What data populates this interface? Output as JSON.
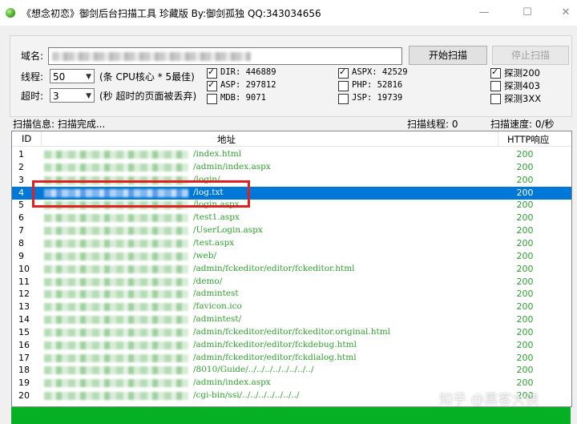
{
  "window": {
    "title": "《想念初恋》御剑后台扫描工具 珍藏版 By:御剑孤独 QQ:343034656",
    "minimize": "—",
    "maximize": "☐",
    "close": "✕"
  },
  "form": {
    "domain_label": "域名:",
    "threads_label": "线程:",
    "threads_value": "50",
    "threads_hint": "(条 CPU核心 * 5最佳)",
    "timeout_label": "超时:",
    "timeout_value": "3",
    "timeout_hint": "(秒 超时的页面被丢弃)",
    "start_button": "开始扫描",
    "stop_button": "停止扫描"
  },
  "dictionaries": [
    {
      "label": "DIR: 446889",
      "checked": true
    },
    {
      "label": "ASP: 297812",
      "checked": true
    },
    {
      "label": "MDB: 9071",
      "checked": false
    },
    {
      "label": "ASPX: 42529",
      "checked": true
    },
    {
      "label": "PHP: 52816",
      "checked": false
    },
    {
      "label": "JSP: 19739",
      "checked": false
    },
    {
      "label": "探测200",
      "checked": true
    },
    {
      "label": "探测403",
      "checked": false
    },
    {
      "label": "探测3XX",
      "checked": false
    }
  ],
  "status": {
    "scan_info": "扫描信息: 扫描完成...",
    "scan_threads": "扫描线程: 0",
    "scan_speed": "扫描速度: 0/秒"
  },
  "table": {
    "columns": [
      "ID",
      "地址",
      "HTTP响应"
    ],
    "rows": [
      {
        "id": "1",
        "path": "/index.html",
        "code": "200"
      },
      {
        "id": "2",
        "path": "/admin/index.aspx",
        "code": "200"
      },
      {
        "id": "3",
        "path": "/login/",
        "code": "200"
      },
      {
        "id": "4",
        "path": "/log.txt",
        "code": "200",
        "selected": true
      },
      {
        "id": "5",
        "path": "/login.aspx",
        "code": "200"
      },
      {
        "id": "6",
        "path": "/test1.aspx",
        "code": "200"
      },
      {
        "id": "7",
        "path": "/UserLogin.aspx",
        "code": "200"
      },
      {
        "id": "8",
        "path": "/test.aspx",
        "code": "200"
      },
      {
        "id": "9",
        "path": "/web/",
        "code": "200"
      },
      {
        "id": "10",
        "path": "/admin/fckeditor/editor/fckeditor.html",
        "code": "200"
      },
      {
        "id": "11",
        "path": "/demo/",
        "code": "200"
      },
      {
        "id": "12",
        "path": "/admintest",
        "code": "200"
      },
      {
        "id": "13",
        "path": "/favicon.ico",
        "code": "200"
      },
      {
        "id": "14",
        "path": "/admintest/",
        "code": "200"
      },
      {
        "id": "15",
        "path": "/admin/fckeditor/editor/fckeditor.original.html",
        "code": "200"
      },
      {
        "id": "16",
        "path": "/admin/fckeditor/editor/fckdebug.html",
        "code": "200"
      },
      {
        "id": "17",
        "path": "/admin/fckeditor/editor/fckdialog.html",
        "code": "200"
      },
      {
        "id": "18",
        "path": "/8010/Guide/../../../../../../../../",
        "code": "200"
      },
      {
        "id": "19",
        "path": "/admin/index.aspx",
        "code": "200"
      },
      {
        "id": "20",
        "path": "/cgi-bin/ssi/../../../../../../../",
        "code": "200"
      }
    ]
  },
  "watermark": "知乎 @黑客大侠",
  "colors": {
    "selection": "#0078d7",
    "result_text": "#2ea02e",
    "progress": "#06b025",
    "highlight_box": "#e02020"
  }
}
